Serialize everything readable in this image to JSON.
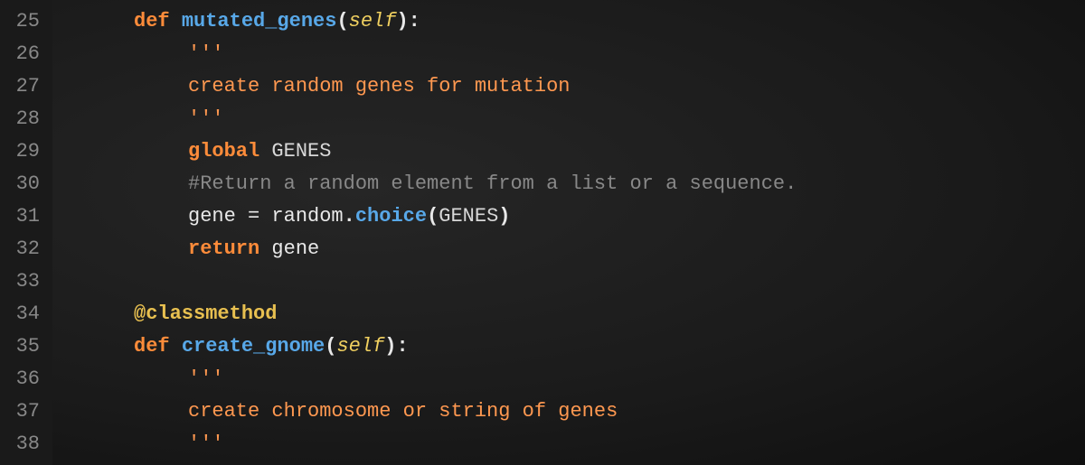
{
  "gutter": {
    "start": 25,
    "end": 38,
    "numbers": [
      "25",
      "26",
      "27",
      "28",
      "29",
      "30",
      "31",
      "32",
      "33",
      "34",
      "35",
      "36",
      "37",
      "38"
    ]
  },
  "code": {
    "l25": {
      "kw_def": "def",
      "fn": "mutated_genes",
      "lp": "(",
      "param": "self",
      "rp": ")",
      "colon": ":"
    },
    "l26": {
      "triple": "'''"
    },
    "l27": {
      "text": "create random genes for mutation"
    },
    "l28": {
      "triple": "'''"
    },
    "l29": {
      "kw_global": "global",
      "const": "GENES"
    },
    "l30": {
      "comment": "#Return a random element from a list or a sequence."
    },
    "l31": {
      "id_gene": "gene",
      "eq": " = ",
      "mod": "random",
      "dot": ".",
      "fn": "choice",
      "lp": "(",
      "arg": "GENES",
      "rp": ")"
    },
    "l32": {
      "kw_return": "return",
      "id_gene": "gene"
    },
    "l33": {
      "blank": ""
    },
    "l34": {
      "decorator": "@classmethod"
    },
    "l35": {
      "kw_def": "def",
      "fn": "create_gnome",
      "lp": "(",
      "param": "self",
      "rp": ")",
      "colon": ":"
    },
    "l36": {
      "triple": "'''"
    },
    "l37": {
      "text": "create chromosome or string of genes"
    },
    "l38": {
      "triple": "'''"
    }
  }
}
